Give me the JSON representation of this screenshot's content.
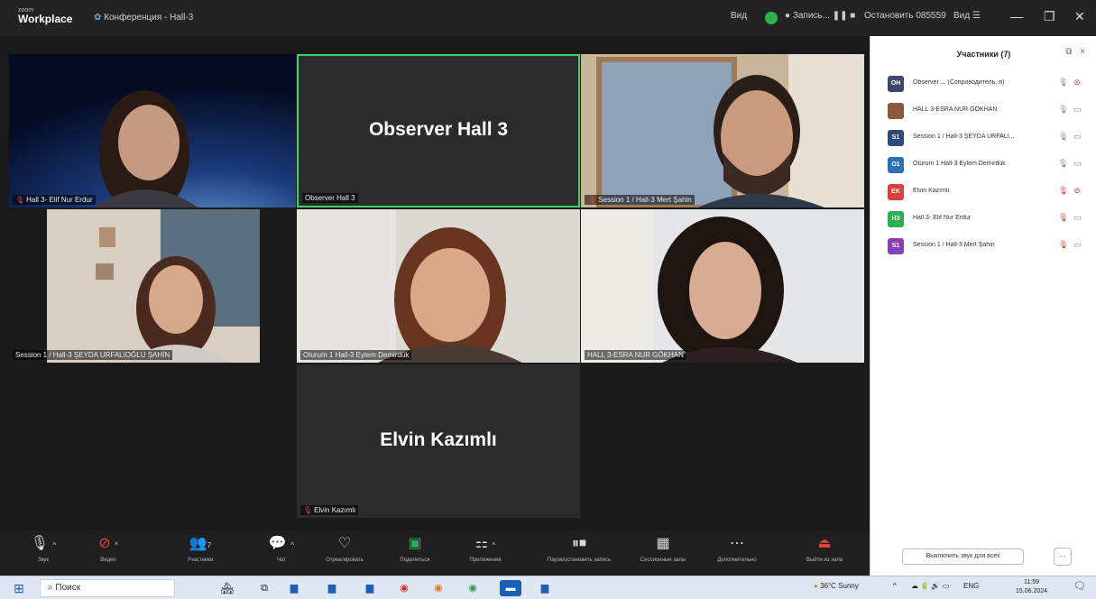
{
  "titlebar": {
    "brand_small": "zoom",
    "brand_big": "Workplace",
    "meeting_title": "Конференция - Hall-3",
    "view_label": "Вид",
    "record_label": "Запись...",
    "stop_label": "Остановить 085559",
    "view2_label": "Вид ☰",
    "minimize": "—",
    "restore": "❐",
    "close": "✕"
  },
  "tiles": [
    {
      "name": "Hall 3- Elif Nur Erdur",
      "muted": true
    },
    {
      "name": "Observer Hall 3",
      "big_name": "Observer Hall 3",
      "muted": false
    },
    {
      "name": "Session 1 / Hall-3 Mert Şahin",
      "muted": true
    },
    {
      "name": "Session 1 / Hall-3 ŞEYDA URFALIOĞLU ŞAHİN",
      "muted": false
    },
    {
      "name": "Oturum 1 Hall-3 Eylem Demirdük",
      "muted": false
    },
    {
      "name": "HALL 3-ESRA NUR GÖKHAN",
      "muted": false
    },
    {
      "name": "Elvin Kazımlı",
      "big_name": "Elvin Kazımlı",
      "muted": true
    }
  ],
  "toolbar": {
    "audio": "Звук",
    "video": "Видео",
    "participants": "Участники",
    "participants_count": "7",
    "chat": "Чат",
    "react": "Отреагировать",
    "share": "Поделиться",
    "apps": "Приложения",
    "pause_record": "Пауза/остановить запись",
    "breakout": "Сессионные залы",
    "more": "Дополнительно",
    "leave": "Выйти из зала"
  },
  "panel": {
    "title": "Участники (7)",
    "mute_all": "Выключить звук для всех",
    "more": "···",
    "participants": [
      {
        "initials": "OH",
        "color": "#3b4a6b",
        "name": "Observer ... (Сопроводитель, я)"
      },
      {
        "initials": "",
        "color": "#8a5a3a",
        "name": "HALL 3-ESRA NUR GÖKHAN"
      },
      {
        "initials": "S1",
        "color": "#2f4a7a",
        "name": "Session 1 / Hall-3 ŞEYDA URFALI..."
      },
      {
        "initials": "O1",
        "color": "#2c6fb5",
        "name": "Oturum 1 Hall-3 Eylem Demirdük"
      },
      {
        "initials": "EK",
        "color": "#d9413a",
        "name": "Elvin Kazımlı"
      },
      {
        "initials": "H3",
        "color": "#2eaf55",
        "name": "Hall 3- Elif Nur Erdur"
      },
      {
        "initials": "S1",
        "color": "#8a3fb7",
        "name": "Session 1 / Hall-3 Mert Şahin"
      }
    ]
  },
  "taskbar": {
    "search": "Поиск",
    "weather": "36°C Sunny",
    "lang": "ENG",
    "time": "11:59",
    "date": "15.06.2024"
  }
}
